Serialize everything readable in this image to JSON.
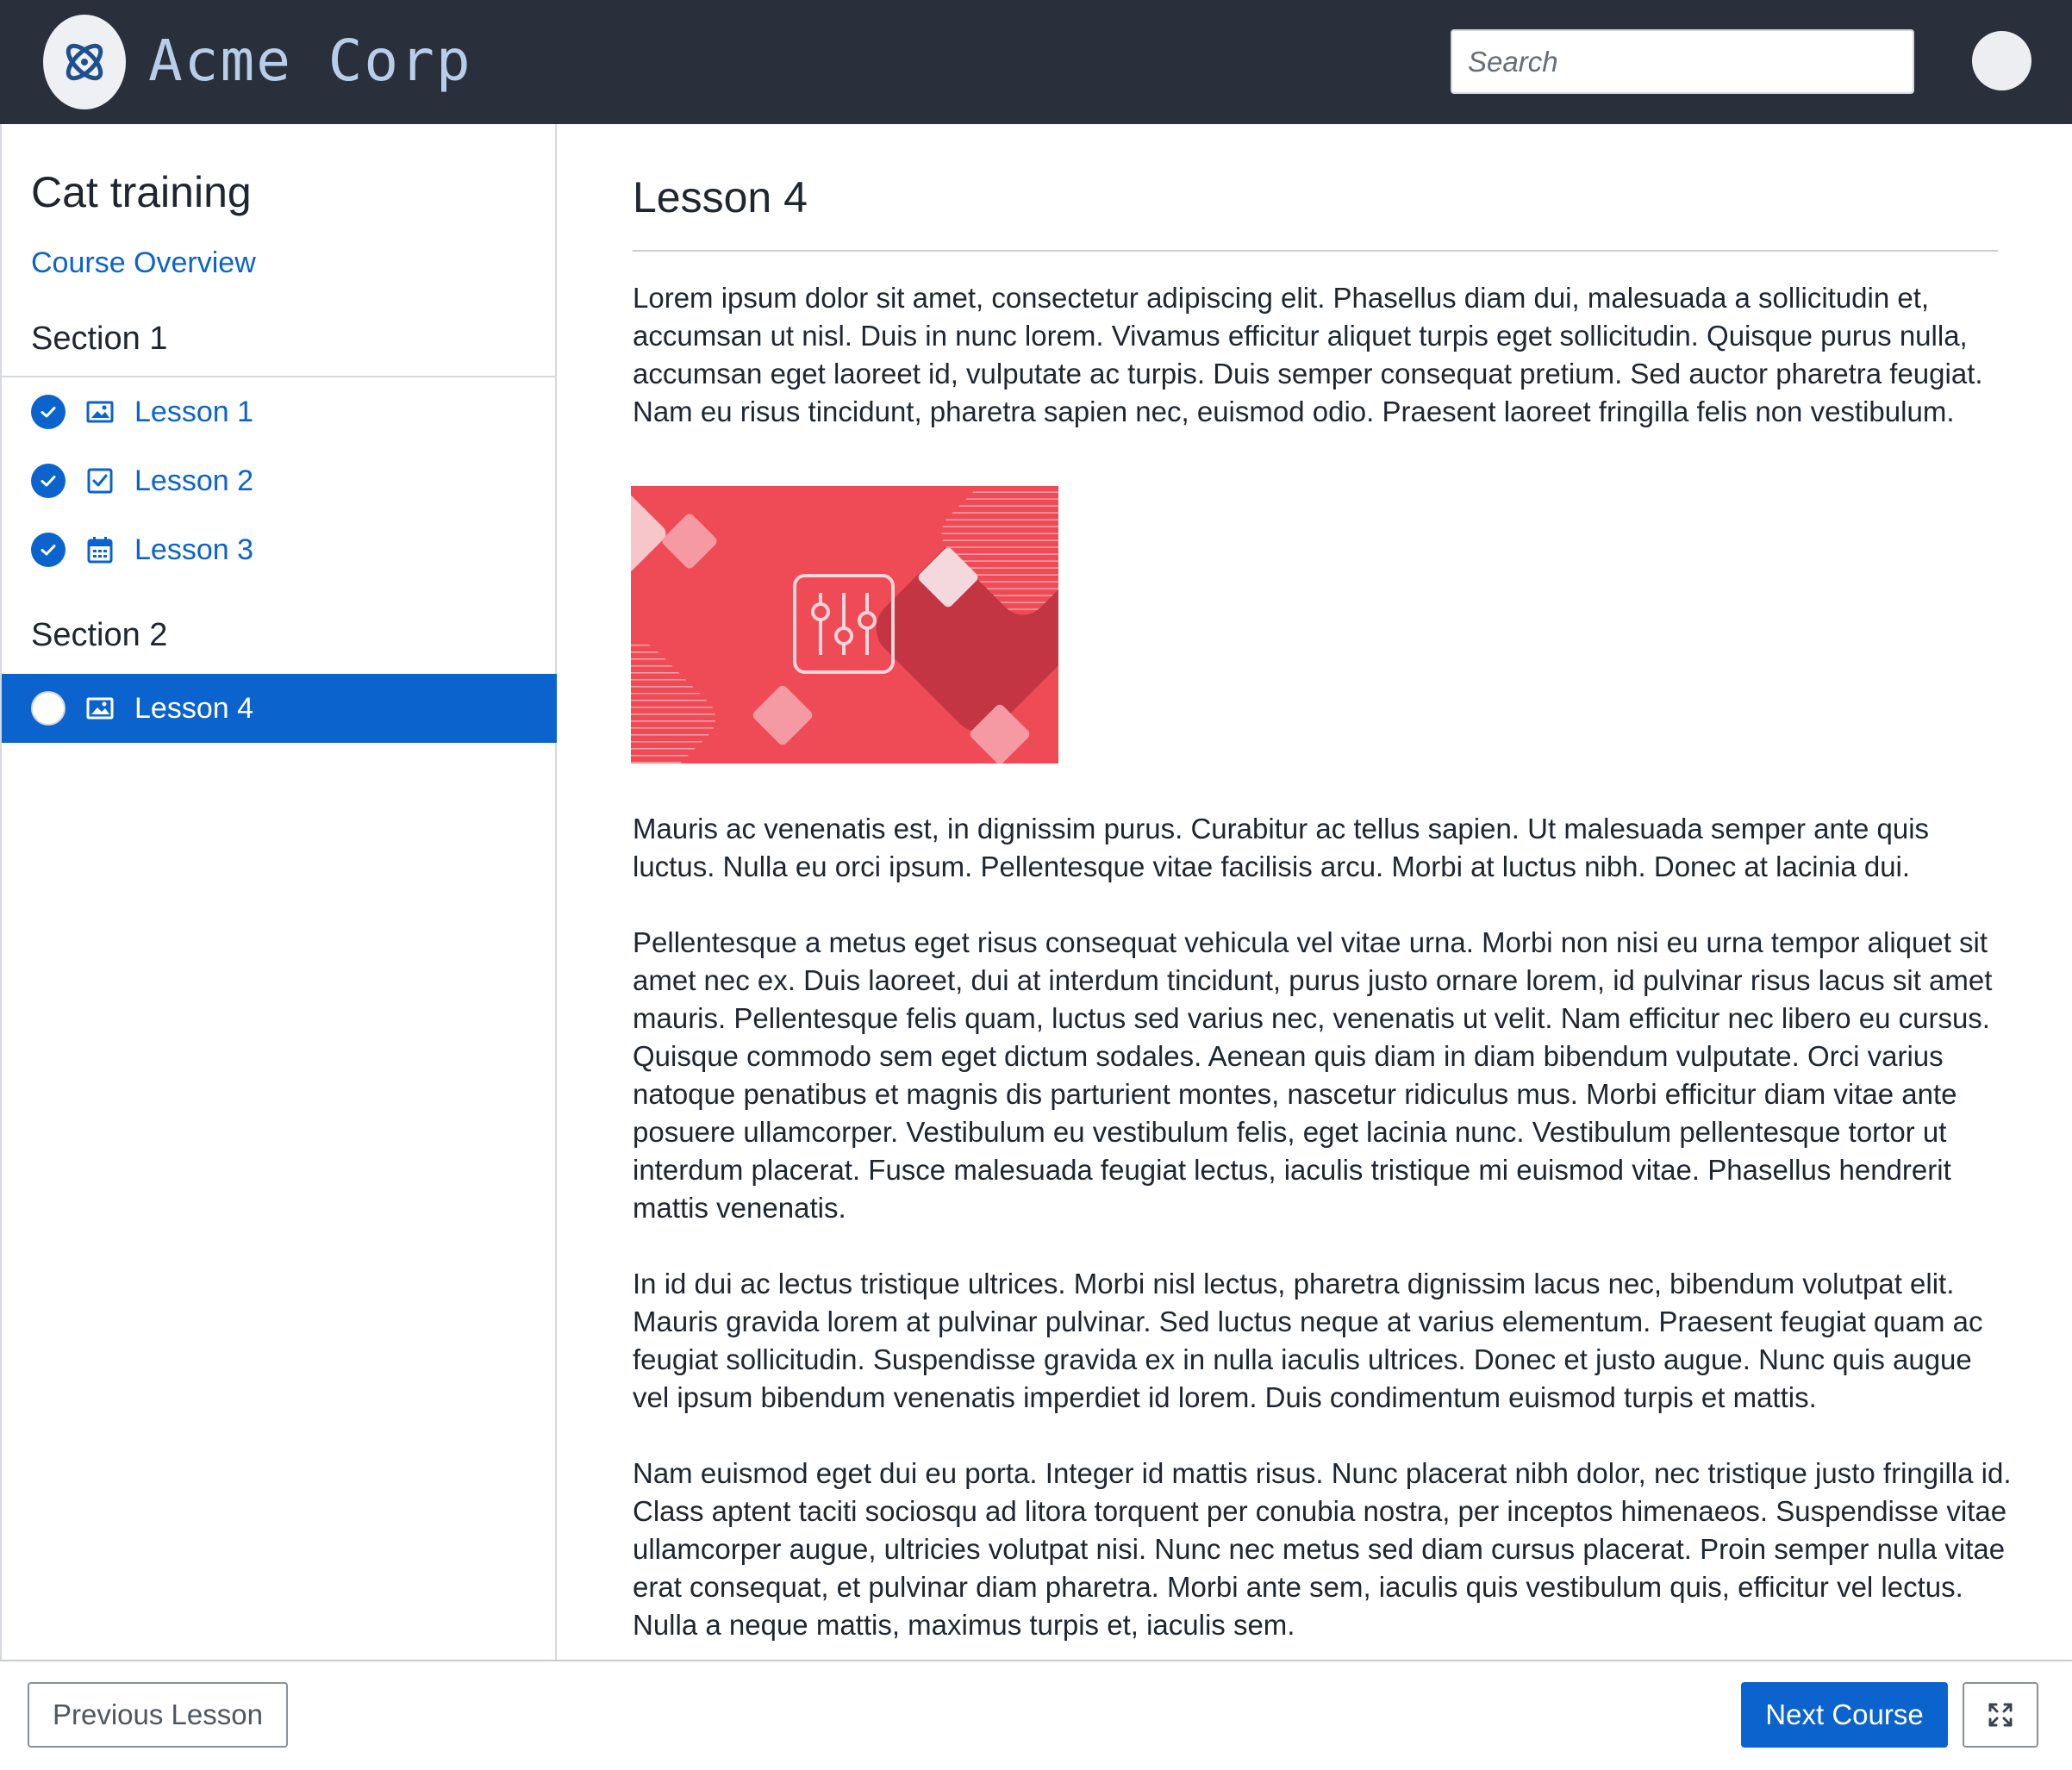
{
  "header": {
    "brand": "Acme Corp",
    "logo_icon": "atom-icon",
    "search_placeholder": "Search",
    "avatar_icon": "user-avatar"
  },
  "sidebar": {
    "course_title": "Cat training",
    "course_overview_label": "Course Overview",
    "sections": [
      {
        "title": "Section 1",
        "lessons": [
          {
            "label": "Lesson 1",
            "type_icon": "image-icon",
            "status": "complete"
          },
          {
            "label": "Lesson 2",
            "type_icon": "checkbox-icon",
            "status": "complete"
          },
          {
            "label": "Lesson 3",
            "type_icon": "calendar-icon",
            "status": "complete"
          }
        ]
      },
      {
        "title": "Section 2",
        "lessons": [
          {
            "label": "Lesson 4",
            "type_icon": "image-icon",
            "status": "current"
          }
        ]
      }
    ]
  },
  "main": {
    "lesson_title": "Lesson 4",
    "paragraphs": [
      "Lorem ipsum dolor sit amet, consectetur adipiscing elit. Phasellus diam dui, malesuada a sollicitudin et, accumsan ut nisl. Duis in nunc lorem. Vivamus efficitur aliquet turpis eget sollicitudin. Quisque purus nulla, accumsan eget laoreet id, vulputate ac turpis. Duis semper consequat pretium. Sed auctor pharetra feugiat. Nam eu risus tincidunt, pharetra sapien nec, euismod odio. Praesent laoreet fringilla felis non vestibulum.",
      "Mauris ac venenatis est, in dignissim purus. Curabitur ac tellus sapien. Ut malesuada semper ante quis luctus. Nulla eu orci ipsum. Pellentesque vitae facilisis arcu. Morbi at luctus nibh. Donec at lacinia dui.",
      "Pellentesque a metus eget risus consequat vehicula vel vitae urna. Morbi non nisi eu urna tempor aliquet sit amet nec ex. Duis laoreet, dui at interdum tincidunt, purus justo ornare lorem, id pulvinar risus lacus sit amet mauris. Pellentesque felis quam, luctus sed varius nec, venenatis ut velit. Nam efficitur nec libero eu cursus. Quisque commodo sem eget dictum sodales. Aenean quis diam in diam bibendum vulputate. Orci varius natoque penatibus et magnis dis parturient montes, nascetur ridiculus mus. Morbi efficitur diam vitae ante posuere ullamcorper. Vestibulum eu vestibulum felis, eget lacinia nunc. Vestibulum pellentesque tortor ut interdum placerat. Fusce malesuada feugiat lectus, iaculis tristique mi euismod vitae. Phasellus hendrerit mattis venenatis.",
      "In id dui ac lectus tristique ultrices. Morbi nisl lectus, pharetra dignissim lacus nec, bibendum volutpat elit. Mauris gravida lorem at pulvinar pulvinar. Sed luctus neque at varius elementum. Praesent feugiat quam ac feugiat sollicitudin. Suspendisse gravida ex in nulla iaculis ultrices. Donec et justo augue. Nunc quis augue vel ipsum bibendum venenatis imperdiet id lorem. Duis condimentum euismod turpis et mattis.",
      "Nam euismod eget dui eu porta. Integer id mattis risus. Nunc placerat nibh dolor, nec tristique justo fringilla id. Class aptent taciti sociosqu ad litora torquent per conubia nostra, per inceptos himenaeos. Suspendisse vitae ullamcorper augue, ultricies volutpat nisi. Nunc nec metus sed diam cursus placerat. Proin semper nulla vitae erat consequat, et pulvinar diam pharetra. Morbi ante sem, iaculis quis vestibulum quis, efficitur vel lectus. Nulla a neque mattis, maximus turpis et, iaculis sem."
    ],
    "image_icon": "sliders-icon"
  },
  "footer": {
    "previous_label": "Previous Lesson",
    "next_label": "Next Course",
    "expand_icon": "expand-icon"
  },
  "colors": {
    "header_bg": "#2a303b",
    "accent": "#0b63ce",
    "brand_text": "#b7cdea",
    "image_bg": "#ef4b57"
  }
}
